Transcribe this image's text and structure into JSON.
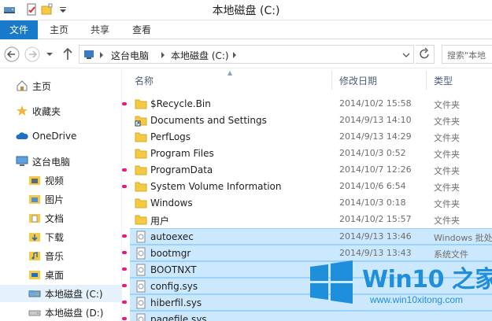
{
  "window": {
    "title": "本地磁盘 (C:)"
  },
  "ribbon": {
    "tabs": [
      "文件",
      "主页",
      "共享",
      "查看"
    ]
  },
  "address": {
    "crumbs": [
      "这台电脑",
      "本地磁盘 (C:)"
    ],
    "search_placeholder": "搜索\"本地"
  },
  "sidebar": {
    "items": [
      {
        "label": "主页",
        "icon": "home-icon"
      },
      {
        "label": "收藏夹",
        "icon": "star-icon"
      },
      {
        "label": "OneDrive",
        "icon": "cloud-icon"
      },
      {
        "label": "这台电脑",
        "icon": "computer-icon"
      },
      {
        "label": "视频",
        "icon": "video-folder-icon"
      },
      {
        "label": "图片",
        "icon": "pictures-folder-icon"
      },
      {
        "label": "文档",
        "icon": "documents-folder-icon"
      },
      {
        "label": "下载",
        "icon": "downloads-folder-icon"
      },
      {
        "label": "音乐",
        "icon": "music-folder-icon"
      },
      {
        "label": "桌面",
        "icon": "desktop-folder-icon"
      },
      {
        "label": "本地磁盘 (C:)",
        "icon": "drive-icon"
      },
      {
        "label": "本地磁盘 (D:)",
        "icon": "drive-icon"
      }
    ]
  },
  "list": {
    "columns": {
      "name": "名称",
      "date": "修改日期",
      "type": "类型"
    },
    "files": [
      {
        "name": "$Recycle.Bin",
        "date": "2014/10/2 15:58",
        "type": "文件夹",
        "kind": "folder"
      },
      {
        "name": "Documents and Settings",
        "date": "2014/9/13 14:10",
        "type": "文件夹",
        "kind": "shortcut"
      },
      {
        "name": "PerfLogs",
        "date": "2014/9/13 14:29",
        "type": "文件夹",
        "kind": "folder"
      },
      {
        "name": "Program Files",
        "date": "2014/10/3 0:52",
        "type": "文件夹",
        "kind": "folder"
      },
      {
        "name": "ProgramData",
        "date": "2014/10/7 12:26",
        "type": "文件夹",
        "kind": "folder"
      },
      {
        "name": "System Volume Information",
        "date": "2014/10/6 6:54",
        "type": "文件夹",
        "kind": "folder"
      },
      {
        "name": "Windows",
        "date": "2014/10/3 0:18",
        "type": "文件夹",
        "kind": "folder"
      },
      {
        "name": "用户",
        "date": "2014/10/2 15:57",
        "type": "文件夹",
        "kind": "folder"
      },
      {
        "name": "autoexec",
        "date": "2014/9/13 13:46",
        "type": "Windows 批处",
        "kind": "file"
      },
      {
        "name": "bootmgr",
        "date": "2014/9/13 13:43",
        "type": "系统文件",
        "kind": "file"
      },
      {
        "name": "BOOTNXT",
        "date": "",
        "type": "",
        "kind": "file"
      },
      {
        "name": "config.sys",
        "date": "",
        "type": "",
        "kind": "file"
      },
      {
        "name": "hiberfil.sys",
        "date": "",
        "type": "",
        "kind": "file"
      },
      {
        "name": "pagefile.sys",
        "date": "",
        "type": "",
        "kind": "file"
      }
    ]
  },
  "watermark": {
    "title": "Win10 之家",
    "url": "www.win10xitong.com"
  },
  "colors": {
    "accent": "#1979ca",
    "selection": "#cce8ff",
    "marker": "#f0147d",
    "folder": "#f6c944"
  }
}
